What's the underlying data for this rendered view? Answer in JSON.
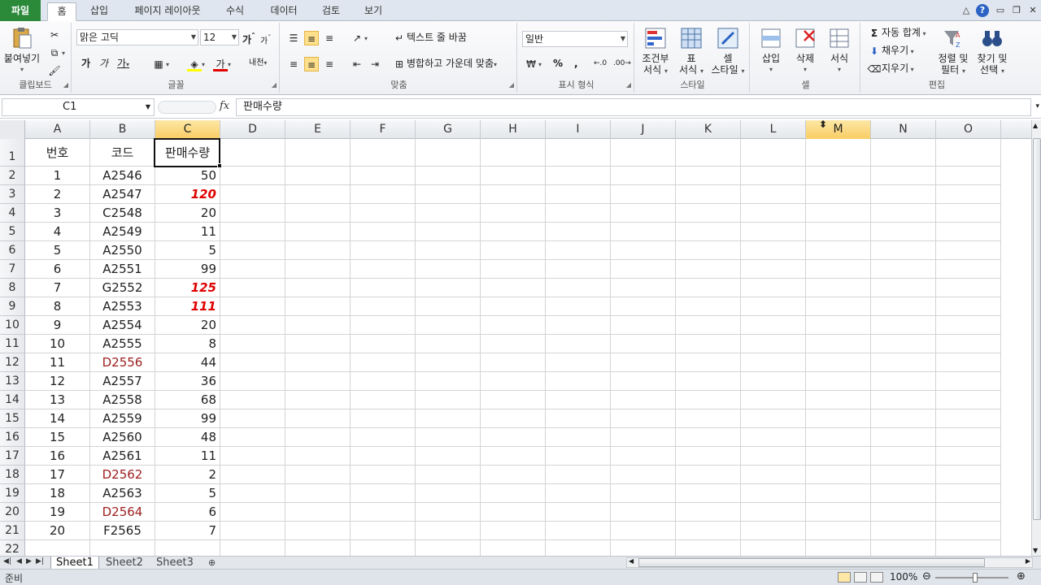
{
  "tabs": {
    "file": "파일",
    "items": [
      "홈",
      "삽입",
      "페이지 레이아웃",
      "수식",
      "데이터",
      "검토",
      "보기"
    ]
  },
  "ribbon": {
    "clipboard": {
      "paste": "붙여넣기",
      "label": "클립보드"
    },
    "font": {
      "name": "맑은 고딕",
      "size": "12",
      "label": "글꼴",
      "bold": "가",
      "italic": "가",
      "underline": "가",
      "grow": "가",
      "shrink": "가",
      "color_letter": "가",
      "phonetic": "내천"
    },
    "alignment": {
      "wrap": "텍스트 줄 바꿈",
      "merge": "병합하고 가운데 맞춤",
      "label": "맞춤"
    },
    "number": {
      "format": "일반",
      "percent": "%",
      "comma": ",",
      "label": "표시 형식"
    },
    "styles": {
      "conditional": [
        "조건부",
        "서식"
      ],
      "table": [
        "표",
        "서식"
      ],
      "cell": [
        "셀",
        "스타일"
      ],
      "label": "스타일"
    },
    "cells": {
      "insert": "삽입",
      "delete": "삭제",
      "format": "서식",
      "label": "셀"
    },
    "editing": {
      "autosum": "자동 합계",
      "fill": "채우기",
      "clear": "지우기",
      "sort": [
        "정렬 및",
        "필터"
      ],
      "find": [
        "찾기 및",
        "선택"
      ],
      "label": "편집"
    }
  },
  "formula_bar": {
    "name_box": "C1",
    "fx": "fx",
    "content": "판매수량"
  },
  "columns": [
    "A",
    "B",
    "C",
    "D",
    "E",
    "F",
    "G",
    "H",
    "I",
    "J",
    "K",
    "L",
    "M",
    "N",
    "O"
  ],
  "row_numbers": [
    "1",
    "2",
    "3",
    "4",
    "5",
    "6",
    "7",
    "8",
    "9",
    "10",
    "11",
    "12",
    "13",
    "14",
    "15",
    "16",
    "17",
    "18",
    "19",
    "20",
    "21",
    "22"
  ],
  "header_row": {
    "a": "번호",
    "b": "코드",
    "c": "판매수량"
  },
  "rows": [
    {
      "a": "1",
      "b": "A2546",
      "c": "50"
    },
    {
      "a": "2",
      "b": "A2547",
      "c": "120"
    },
    {
      "a": "3",
      "b": "C2548",
      "c": "20"
    },
    {
      "a": "4",
      "b": "A2549",
      "c": "11"
    },
    {
      "a": "5",
      "b": "A2550",
      "c": "5"
    },
    {
      "a": "6",
      "b": "A2551",
      "c": "99"
    },
    {
      "a": "7",
      "b": "G2552",
      "c": "125"
    },
    {
      "a": "8",
      "b": "A2553",
      "c": "111"
    },
    {
      "a": "9",
      "b": "A2554",
      "c": "20"
    },
    {
      "a": "10",
      "b": "A2555",
      "c": "8"
    },
    {
      "a": "11",
      "b": "D2556",
      "c": "44"
    },
    {
      "a": "12",
      "b": "A2557",
      "c": "36"
    },
    {
      "a": "13",
      "b": "A2558",
      "c": "68"
    },
    {
      "a": "14",
      "b": "A2559",
      "c": "99"
    },
    {
      "a": "15",
      "b": "A2560",
      "c": "48"
    },
    {
      "a": "16",
      "b": "A2561",
      "c": "11"
    },
    {
      "a": "17",
      "b": "D2562",
      "c": "2"
    },
    {
      "a": "18",
      "b": "A2563",
      "c": "5"
    },
    {
      "a": "19",
      "b": "D2564",
      "c": "6"
    },
    {
      "a": "20",
      "b": "F2565",
      "c": "7"
    }
  ],
  "sheets": [
    "Sheet1",
    "Sheet2",
    "Sheet3"
  ],
  "status": {
    "text": "준비",
    "zoom": "100%"
  },
  "colors": {
    "accent_file": "#2a8a3a",
    "highlight_red": "#e00000",
    "dark_red": "#9c1c1c",
    "selected_header": "#f8cd63"
  }
}
